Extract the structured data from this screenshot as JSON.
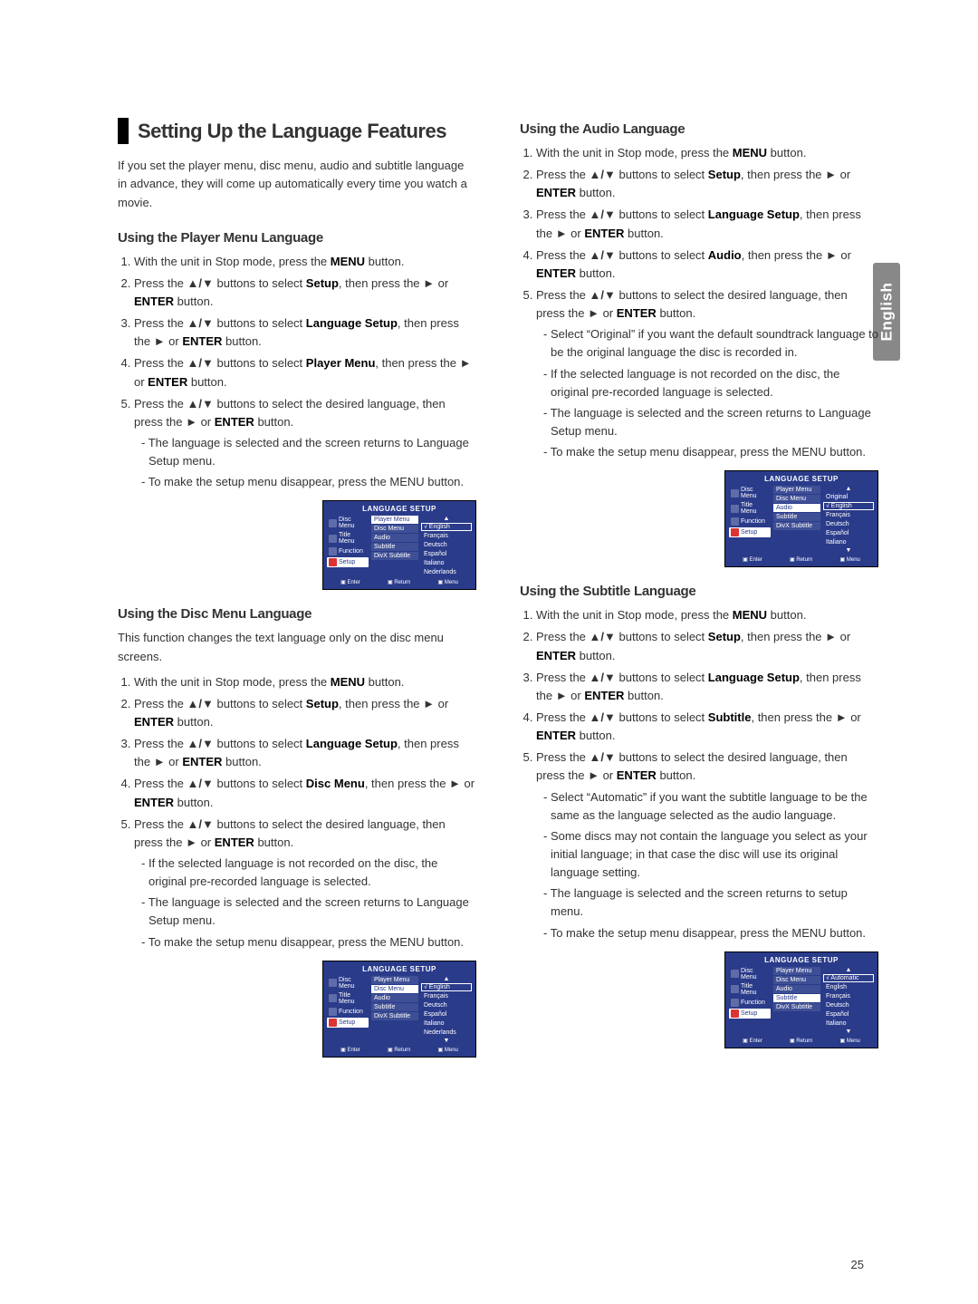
{
  "page_number": "25",
  "side_tab": "English",
  "arrows": "▲/▼",
  "play": "►",
  "left": {
    "title": "Setting Up the Language Features",
    "lead": "If you set the player menu, disc menu, audio and subtitle language in advance, they will come up automatically every time you watch a movie.",
    "s1": {
      "h": "Using the Player Menu Language",
      "steps": [
        {
          "pre": "With the unit in Stop mode, press the ",
          "b": "MENU",
          "post": " button."
        },
        {
          "pre": "Press the ",
          "mid": " buttons to select ",
          "b": "Setup",
          "post": ", then press the ",
          "tail": " button.",
          "orEnter": true
        },
        {
          "pre": "Press the ",
          "mid": " buttons to select ",
          "b": "Language Setup",
          "post": ", then press the ",
          "tail": " button.",
          "orEnter": true
        },
        {
          "pre": "Press the ",
          "mid": " buttons to select ",
          "b": "Player Menu",
          "post": ", then press the ",
          "tail": " button.",
          "orEnter": true
        },
        {
          "pre": "Press the ",
          "mid": " buttons to select the desired language, then press the ",
          "tail": " button.",
          "orEnter": true,
          "bullets": [
            "The language is selected and the screen returns to Language Setup menu.",
            "To make the setup menu disappear, press the MENU button."
          ]
        }
      ]
    },
    "osd1": {
      "title": "LANGUAGE SETUP",
      "nav": [
        "Disc Menu",
        "Title Menu",
        "Function",
        "Setup"
      ],
      "nav_active": 3,
      "mid": [
        "Player Menu",
        "Disc Menu",
        "Audio",
        "Subtitle",
        "DivX Subtitle"
      ],
      "mid_hl": 0,
      "opt_top_arrow": true,
      "opt": [
        "English",
        "Français",
        "Deutsch",
        "Español",
        "Italiano",
        "Nederlands"
      ],
      "opt_sel": 0,
      "opt_bot_arrow": false,
      "foot": [
        "Enter",
        "Return",
        "Menu"
      ]
    },
    "s2": {
      "h": "Using the Disc Menu Language",
      "lead": "This function changes the text language only on the disc menu screens.",
      "steps": [
        {
          "pre": "With the unit in Stop mode, press the ",
          "b": "MENU",
          "post": " button."
        },
        {
          "pre": "Press the ",
          "mid": " buttons to select ",
          "b": "Setup",
          "post": ", then press the ",
          "tail": " button.",
          "orEnter": true
        },
        {
          "pre": "Press the ",
          "mid": " buttons to select ",
          "b": "Language Setup",
          "post": ", then press the ",
          "tail": " button.",
          "orEnter": true
        },
        {
          "pre": "Press the ",
          "mid": " buttons to select ",
          "b": "Disc Menu",
          "post": ", then press the ",
          "tail": "  button.",
          "orEnter": true
        },
        {
          "pre": "Press the ",
          "mid": " buttons to select the desired language, then press the ",
          "tail": " button.",
          "orEnter": true,
          "bullets": [
            "If the selected language is not recorded on  the disc, the original pre-recorded language is selected.",
            "The language is selected and the screen returns to Language Setup menu.",
            "To make the setup menu disappear, press the MENU button."
          ]
        }
      ]
    },
    "osd2": {
      "title": "LANGUAGE SETUP",
      "nav": [
        "Disc Menu",
        "Title Menu",
        "Function",
        "Setup"
      ],
      "nav_active": 3,
      "mid": [
        "Player Menu",
        "Disc Menu",
        "Audio",
        "Subtitle",
        "DivX Subtitle"
      ],
      "mid_hl": 1,
      "opt_top_arrow": true,
      "opt": [
        "English",
        "Français",
        "Deutsch",
        "Español",
        "Italiano",
        "Nederlands"
      ],
      "opt_sel": 0,
      "opt_bot_arrow": true,
      "foot": [
        "Enter",
        "Return",
        "Menu"
      ]
    }
  },
  "right": {
    "s1": {
      "h": "Using the Audio Language",
      "steps": [
        {
          "pre": "With the unit in Stop mode, press the ",
          "b": "MENU",
          "post": " button."
        },
        {
          "pre": "Press the ",
          "mid": " buttons to select ",
          "b": "Setup",
          "post": ", then press the ",
          "tail": " button.",
          "orEnter": true
        },
        {
          "pre": "Press the ",
          "mid": " buttons to select ",
          "b": "Language Setup",
          "post": ", then press the ",
          "tail": " button.",
          "orEnter": true
        },
        {
          "pre": "Press the ",
          "mid": " buttons to select ",
          "b": "Audio",
          "post": ", then press the ",
          "tail": " button.",
          "orEnter": true
        },
        {
          "pre": "Press the ",
          "mid": " buttons to select the desired language, then press the ",
          "tail": " button.",
          "orEnter": true,
          "bullets": [
            "Select “Original” if you want the default soundtrack language to be the original language the disc is recorded in.",
            "If the selected language is not recorded on the disc, the original pre-recorded language is selected.",
            "The language is selected and the screen returns to Language Setup menu.",
            "To make the setup menu disappear, press the MENU button."
          ]
        }
      ]
    },
    "osd1": {
      "title": "LANGUAGE SETUP",
      "nav": [
        "Disc Menu",
        "Title Menu",
        "Function",
        "Setup"
      ],
      "nav_active": 3,
      "mid": [
        "Player Menu",
        "Disc Menu",
        "Audio",
        "Subtitle",
        "DivX Subtitle"
      ],
      "mid_hl": 2,
      "opt_top_arrow": true,
      "opt": [
        "Original",
        "English",
        "Français",
        "Deutsch",
        "Español",
        "Italiano"
      ],
      "opt_sel": 1,
      "opt_bot_arrow": true,
      "foot": [
        "Enter",
        "Return",
        "Menu"
      ]
    },
    "s2": {
      "h": "Using the Subtitle Language",
      "steps": [
        {
          "pre": "With the unit in Stop mode, press the ",
          "b": "MENU",
          "post": " button."
        },
        {
          "pre": "Press the ",
          "mid": " buttons to select ",
          "b": "Setup",
          "post": ", then press the ",
          "tail": " button.",
          "orEnter": true
        },
        {
          "pre": "Press the ",
          "mid": " buttons to select ",
          "b": "Language Setup",
          "post": ", then press the ",
          "tail": " button.",
          "orEnter": true
        },
        {
          "pre": "Press the ",
          "mid": " buttons to select ",
          "b": "Subtitle",
          "post": ", then press the ",
          "tail": " button.",
          "orEnter": true
        },
        {
          "pre": "Press the ",
          "mid": " buttons to select the desired  language, then press the ",
          "tail": " button.",
          "orEnter": true,
          "bullets": [
            "Select “Automatic” if you want the subtitle  language to be the same as the language selected as the audio language.",
            "Some discs may not contain the language you select as your initial language; in that case the disc will use its original language setting.",
            "The language is selected and the screen returns to setup menu.",
            "To make the setup menu disappear, press the MENU button."
          ]
        }
      ]
    },
    "osd2": {
      "title": "LANGUAGE SETUP",
      "nav": [
        "Disc Menu",
        "Title Menu",
        "Function",
        "Setup"
      ],
      "nav_active": 3,
      "mid": [
        "Player Menu",
        "Disc Menu",
        "Audio",
        "Subtitle",
        "DivX Subtitle"
      ],
      "mid_hl": 3,
      "opt_top_arrow": true,
      "opt": [
        "Automatic",
        "English",
        "Français",
        "Deutsch",
        "Español",
        "Italiano"
      ],
      "opt_sel": 0,
      "opt_bot_arrow": true,
      "foot": [
        "Enter",
        "Return",
        "Menu"
      ]
    }
  }
}
